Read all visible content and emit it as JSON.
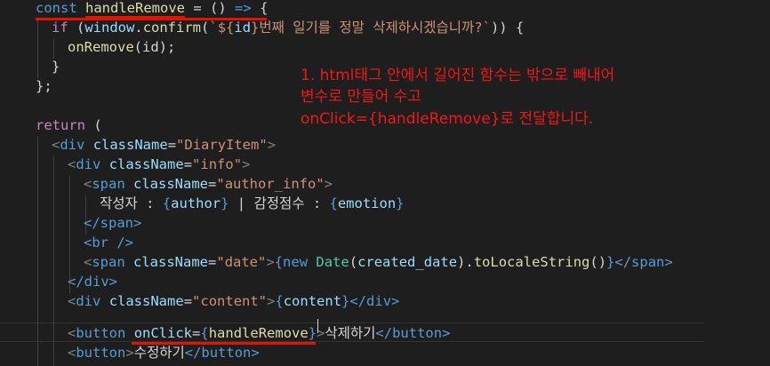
{
  "code": {
    "l1": {
      "kw": "const",
      "name": "handleRemove",
      "op": "=",
      "args": "()",
      "arrow": "=>",
      "brace": "{"
    },
    "l2": {
      "kw": "if",
      "obj": "window",
      "meth": "confirm",
      "tpl_open": "`${",
      "id": "id",
      "tpl_rest": "}번째 일기를 정말 삭제하시겠습니까?`",
      "end": ")) {"
    },
    "l3": {
      "fn": "onRemove",
      "args": "(id);"
    },
    "l4": "}",
    "l5": "};",
    "l7": {
      "kw": "return",
      "paren": "("
    },
    "l8": {
      "tag": "div",
      "attr": "className",
      "val": "\"DiaryItem\""
    },
    "l9": {
      "tag": "div",
      "attr": "className",
      "val": "\"info\""
    },
    "l10": {
      "tag": "span",
      "attr": "className",
      "val": "\"author_info\""
    },
    "l11": {
      "t1": "작성자 : ",
      "v1": "author",
      "t2": " | 감정점수 : ",
      "v2": "emotion"
    },
    "l12": "</span>",
    "l13": "<br />",
    "l14": {
      "tag": "span",
      "attr": "className",
      "val": "\"date\"",
      "kw": "new",
      "cls": "Date",
      "var": "created_date",
      "meth": "toLocaleString",
      "close": "</span>"
    },
    "l15": "</div>",
    "l16": {
      "tag": "div",
      "attr": "className",
      "val": "\"content\"",
      "var": "content",
      "close": "</div>"
    },
    "l17": {
      "tag": "button",
      "attr": "onClick",
      "fn": "handleRemove",
      "text": "삭제하기",
      "close": "</button>"
    },
    "l18": {
      "tag": "button",
      "text": "수정하기",
      "close": "</button>"
    }
  },
  "note": {
    "line1": "1. html태그 안에서 길어진 함수는 밖으로 빼내어",
    "line2": "변수로 만들어 수고",
    "line3": "onClick={handleRemove}로 전달합니다."
  },
  "colors": {
    "annotation": "#f01818",
    "underline": "#e51400",
    "background": "#1e1e1e"
  }
}
